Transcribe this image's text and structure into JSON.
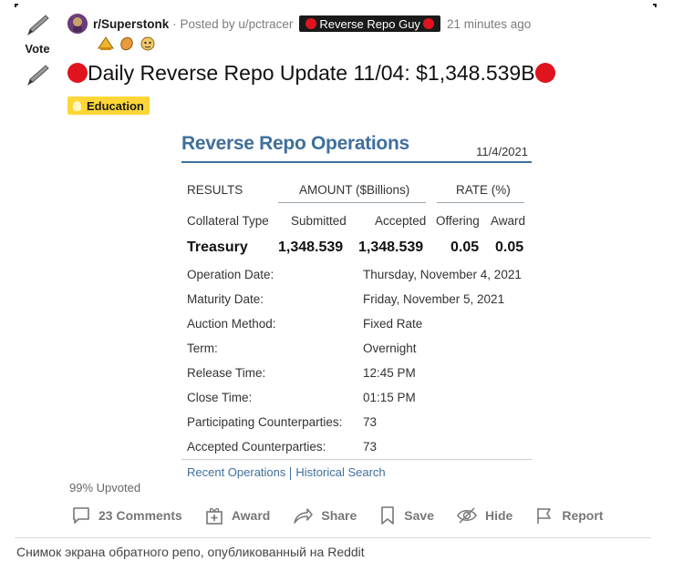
{
  "vote": {
    "label": "Vote"
  },
  "meta": {
    "subreddit": "r/Superstonk",
    "separator": "·",
    "posted_by": "Posted by u/pctracer",
    "user_flair": "Reverse Repo Guy",
    "time_ago": "21 minutes ago"
  },
  "awards": [
    "award-icon",
    "award-icon",
    "award-icon"
  ],
  "post": {
    "title": "Daily Reverse Repo Update 11/04: $1,348.539B",
    "tag": "Education"
  },
  "repo": {
    "title": "Reverse Repo Operations",
    "date": "11/4/2021",
    "results": "RESULTS",
    "amount_header": "AMOUNT ($Billions)",
    "rate_header": "RATE (%)",
    "columns": [
      "Collateral Type",
      "Submitted",
      "Accepted",
      "Offering",
      "Award"
    ],
    "treasury": {
      "type": "Treasury",
      "submitted": "1,348.539",
      "accepted": "1,348.539",
      "offering": "0.05",
      "award": "0.05"
    },
    "details": [
      {
        "label": "Operation Date:",
        "value": "Thursday, November 4, 2021"
      },
      {
        "label": "Maturity Date:",
        "value": "Friday, November 5, 2021"
      },
      {
        "label": "Auction Method:",
        "value": "Fixed Rate"
      },
      {
        "label": "Term:",
        "value": "Overnight"
      },
      {
        "label": "Release Time:",
        "value": "12:45 PM"
      },
      {
        "label": "Close Time:",
        "value": "01:15 PM"
      },
      {
        "label": "Participating Counterparties:",
        "value": "73"
      },
      {
        "label": "Accepted Counterparties:",
        "value": "73"
      }
    ],
    "links": {
      "recent": "Recent Operations",
      "historical": "Historical Search"
    }
  },
  "upvoted": "99% Upvoted",
  "actions": {
    "comments": "23 Comments",
    "award": "Award",
    "share": "Share",
    "save": "Save",
    "hide": "Hide",
    "report": "Report"
  },
  "caption": "Снимок экрана обратного репо, опубликованный на Reddit",
  "colors": {
    "flair_bg": "#1a1a1b",
    "red_dot": "#e0141e",
    "tag_bg": "#ffd635",
    "repo_blue": "#3f6f9c"
  }
}
